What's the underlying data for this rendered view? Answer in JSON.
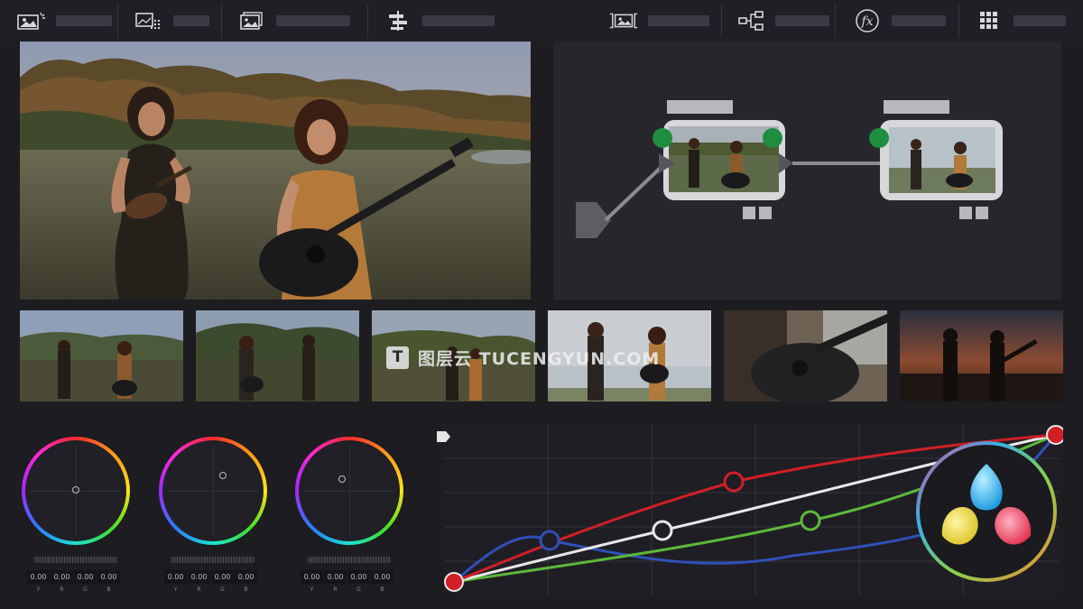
{
  "toolbar": {
    "left_items": [
      {
        "icon": "media-pool-icon"
      },
      {
        "icon": "gallery-icon"
      },
      {
        "icon": "still-image-icon"
      },
      {
        "icon": "timeline-align-icon"
      }
    ],
    "right_items": [
      {
        "icon": "clip-viewer-icon"
      },
      {
        "icon": "node-tree-icon"
      },
      {
        "icon": "effects-fx-icon",
        "glyph": "fx"
      },
      {
        "icon": "grid-layout-icon"
      }
    ]
  },
  "viewer": {
    "content": "two women performing with ukulele and guitar in a field"
  },
  "thumbnails": [
    {
      "index": 1
    },
    {
      "index": 2
    },
    {
      "index": 3
    },
    {
      "index": 4
    },
    {
      "index": 5
    },
    {
      "index": 6
    }
  ],
  "color_wheels": [
    {
      "id": "lift",
      "values": [
        "0.00",
        "0.00",
        "0.00",
        "0.00"
      ],
      "labels": [
        "Y",
        "R",
        "G",
        "B"
      ]
    },
    {
      "id": "gamma",
      "values": [
        "0.00",
        "0.00",
        "0.00",
        "0.00"
      ],
      "labels": [
        "Y",
        "R",
        "G",
        "B"
      ]
    },
    {
      "id": "gain",
      "values": [
        "0.00",
        "0.00",
        "0.00",
        "0.00"
      ],
      "labels": [
        "Y",
        "R",
        "G",
        "B"
      ]
    }
  ],
  "curves": {
    "colors": {
      "red": "#d01f25",
      "white": "#e8e8e8",
      "green": "#5cb83a",
      "blue": "#2f50b8"
    }
  },
  "watermark": {
    "logo": "T",
    "text": "图层云 TUCENGYUN.COM"
  },
  "logo": {
    "name": "davinci-resolve-logo"
  }
}
